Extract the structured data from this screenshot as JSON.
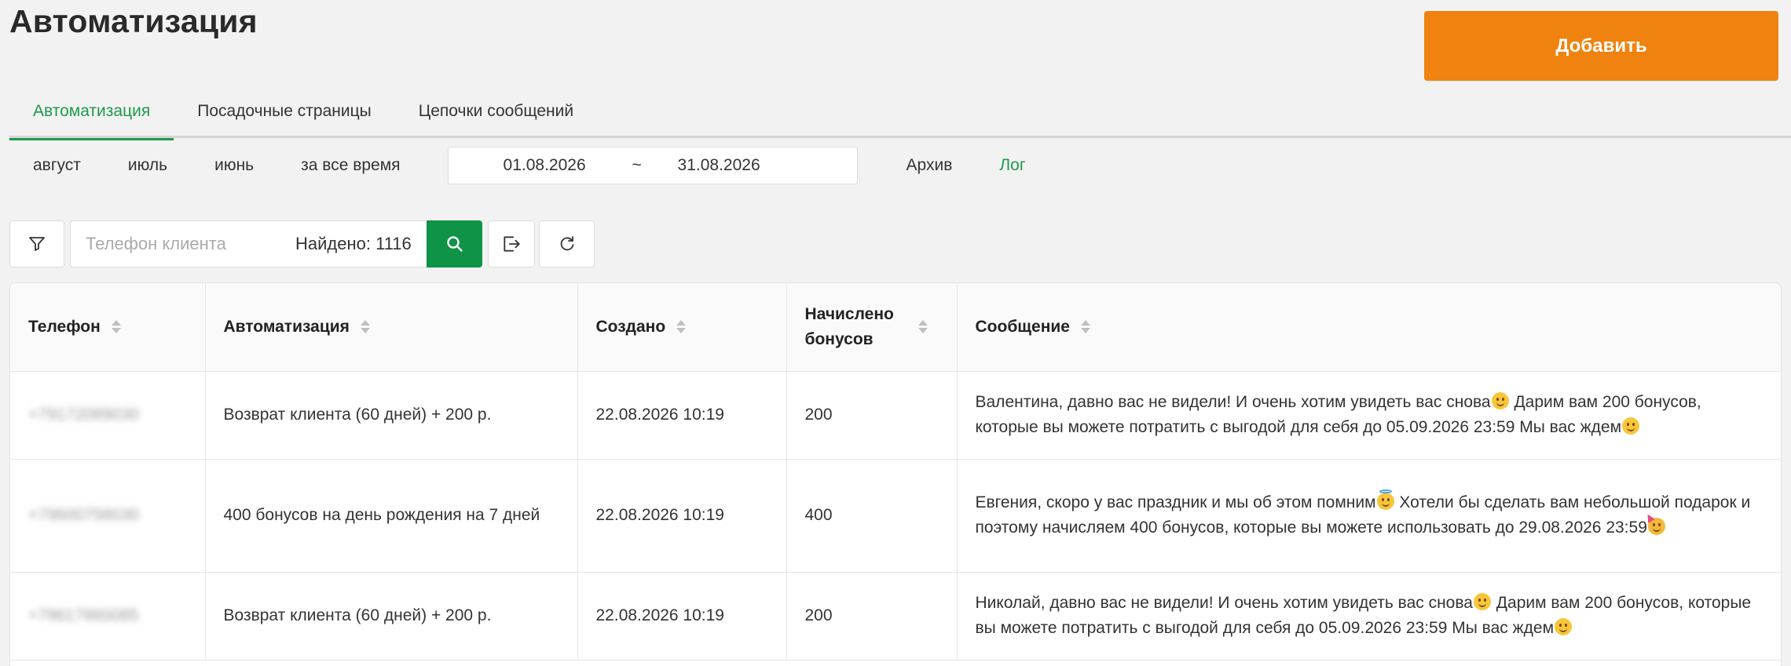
{
  "header": {
    "title": "Автоматизация",
    "add_button": "Добавить"
  },
  "tabs": [
    {
      "label": "Автоматизация",
      "active": true
    },
    {
      "label": "Посадочные страницы",
      "active": false
    },
    {
      "label": "Цепочки сообщений",
      "active": false
    }
  ],
  "periods": [
    "август",
    "июль",
    "июнь",
    "за все время"
  ],
  "date_range": {
    "from": "01.08.2026",
    "separator": "~",
    "to": "31.08.2026"
  },
  "links": {
    "archive": "Архив",
    "log": "Лог"
  },
  "toolbar": {
    "filter_icon": "filter-icon",
    "search_placeholder": "Телефон клиента",
    "search_value": "",
    "found_label": "Найдено: 1116",
    "search_icon": "search-icon",
    "export_icon": "export-icon",
    "refresh_icon": "refresh-icon"
  },
  "table": {
    "columns": [
      {
        "label": "Телефон"
      },
      {
        "label": "Автоматизация"
      },
      {
        "label": "Создано"
      },
      {
        "label": "Начислено бонусов"
      },
      {
        "label": "Сообщение"
      }
    ],
    "rows": [
      {
        "phone": "+79172089030",
        "automation": "Возврат клиента (60 дней) + 200 р.",
        "created": "22.08.2026 10:19",
        "bonus": "200",
        "message_parts": [
          "Валентина, давно вас не видели! И очень хотим увидеть вас снова",
          " Дарим вам 200 бонусов, которые вы можете потратить с выгодой для себя до 05.09.2026 23:59 Мы вас ждем"
        ],
        "emojis": [
          "smiling-face-icon",
          "hugging-face-icon"
        ]
      },
      {
        "phone": "+79600758030",
        "automation": "400 бонусов на день рождения на 7 дней",
        "created": "22.08.2026 10:19",
        "bonus": "400",
        "message_parts": [
          "Евгения, скоро у вас праздник и мы об этом помним",
          " Хотели бы сделать вам небольшой подарок и поэтому начисляем 400 бонусов, которые вы можете использовать до 29.08.2026 23:59"
        ],
        "emojis": [
          "angel-face-icon",
          "party-face-icon"
        ]
      },
      {
        "phone": "+79617860085",
        "automation": "Возврат клиента (60 дней) + 200 р.",
        "created": "22.08.2026 10:19",
        "bonus": "200",
        "message_parts": [
          "Николай, давно вас не видели! И очень хотим увидеть вас снова",
          " Дарим вам 200 бонусов, которые вы можете потратить с выгодой для себя до 05.09.2026 23:59 Мы вас ждем"
        ],
        "emojis": [
          "smiling-face-icon",
          "hugging-face-icon"
        ]
      }
    ]
  },
  "colors": {
    "accent_green": "#1e9a4a",
    "search_button_green": "#0f9347",
    "add_button_orange": "#f0830f"
  }
}
